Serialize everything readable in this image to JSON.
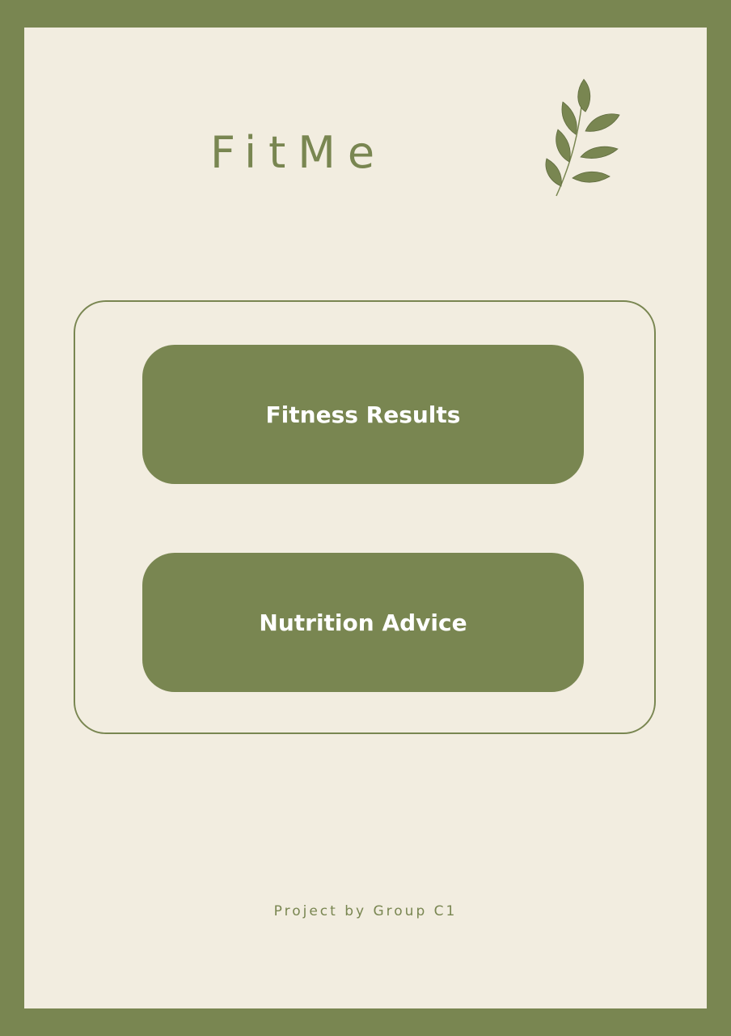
{
  "header": {
    "title": "FitMe"
  },
  "decoration": {
    "icon": "leaf-branch-icon"
  },
  "menu": {
    "fitness_label": "Fitness Results",
    "nutrition_label": "Nutrition Advice"
  },
  "footer": {
    "credit": "Project by Group C1"
  },
  "colors": {
    "accent": "#798651",
    "background": "#f2ede0",
    "button_text": "#ffffff"
  }
}
